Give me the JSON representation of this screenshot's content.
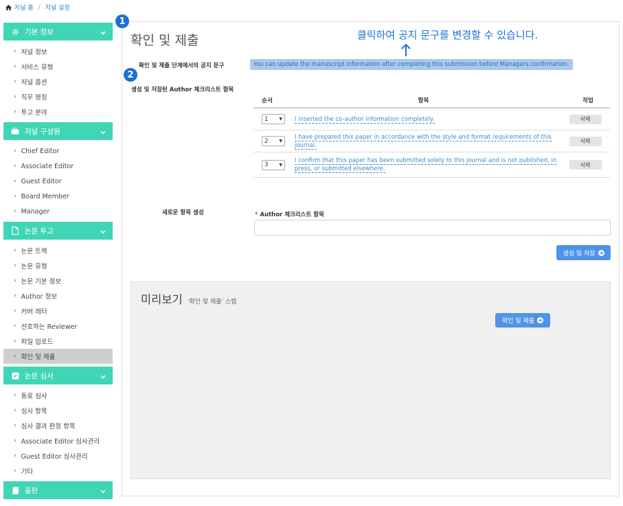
{
  "breadcrumb": {
    "home": "저널 홈",
    "separator": "/",
    "current": "저널 설정"
  },
  "sidebar": {
    "sections": [
      {
        "title": "기본 정보",
        "icon": "gear-icon",
        "items": [
          "저널 정보",
          "서비스 유형",
          "저널 옵션",
          "직무 명칭",
          "투고 분야"
        ]
      },
      {
        "title": "저널 구성원",
        "icon": "briefcase-icon",
        "items": [
          "Chief Editor",
          "Associate Editor",
          "Guest Editor",
          "Board Member",
          "Manager"
        ]
      },
      {
        "title": "논문 투고",
        "icon": "file-icon",
        "items": [
          "논문 트랙",
          "논문 유형",
          "논문 기본 정보",
          "Author 정보",
          "커버 레터",
          "선호하는 Reviewer",
          "파일 업로드",
          "확인 및 제출"
        ]
      },
      {
        "title": "논문 심사",
        "icon": "edit-icon",
        "items": [
          "동료 심사",
          "심사 항목",
          "심사 결과 판정 항목",
          "Associate Editor 심사관리",
          "Guest Editor 심사관리",
          "기타"
        ]
      },
      {
        "title": "출판",
        "icon": "book-icon",
        "items": []
      }
    ],
    "active_item": "확인 및 제출"
  },
  "main": {
    "title": "확인 및 제출",
    "notice_label": "확인 및 제출 단계에서의 공지 문구",
    "notice_text": "You can update the manuscript information after completing this submission before Managers confirmation.",
    "checklist_label": "생성 및 저장된 Author 체크리스트 항목",
    "table": {
      "headers": {
        "order": "순서",
        "item": "항목",
        "action": "작업"
      },
      "rows": [
        {
          "order": "1",
          "text": "I inserted the co-author information completely.",
          "action": "삭제"
        },
        {
          "order": "2",
          "text": "I have prepared this paper in accordance with the style and format requirements of this journal.",
          "action": "삭제"
        },
        {
          "order": "3",
          "text": "I confirm that this paper has been submitted solely to this journal and is not published, in press, or submitted elsewhere.",
          "action": "삭제"
        }
      ]
    },
    "new_item_label": "새로운 항목 생성",
    "field_required_mark": "*",
    "field_label": "Author 체크리스트 항목",
    "field_value": "",
    "save_button": "생성 및 저장",
    "preview": {
      "title": "미리보기",
      "subtitle": "'확인 및 제출' 스텝",
      "confirm_button": "확인 및 제출"
    }
  },
  "annotations": {
    "badge1": "1",
    "badge2": "2",
    "callout": "클릭하여 공지 문구를 변경할 수 있습니다."
  },
  "colors": {
    "accent": "#40d5b5",
    "primary": "#4e94e8",
    "link": "#3a8bc7",
    "annotation": "#1f6fd6"
  }
}
